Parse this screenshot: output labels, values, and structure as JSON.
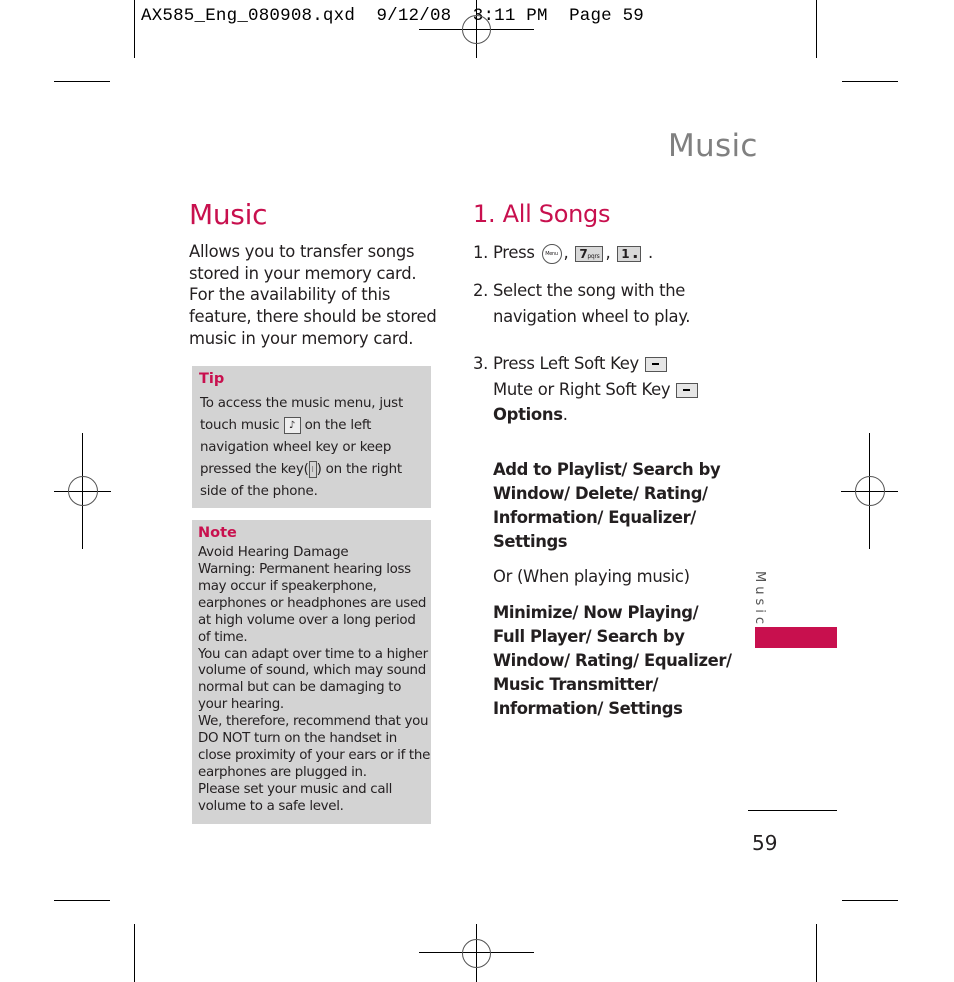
{
  "slug": "AX585_Eng_080908.qxd  9/12/08  3:11 PM  Page 59",
  "running_title": "Music",
  "left_column": {
    "heading": "Music",
    "intro": "Allows you to transfer songs stored in your memory card. For the availability of this feature, there should be stored music in your memory card.",
    "tip": {
      "label": "Tip",
      "text_1": "To access the music menu, just touch music",
      "music_icon": "music-note-icon",
      "text_2": "on the left navigation wheel key or keep pressed the key(",
      "side_key_icon": "side-key-icon",
      "text_3": ") on the right side of the phone."
    },
    "note": {
      "label": "Note",
      "subheading": "Avoid Hearing Damage",
      "paragraphs": [
        "Warning: Permanent hearing loss may occur if speakerphone, earphones or headphones are used at high volume over a long period of time.",
        "You can adapt over time to a higher volume of sound, which may sound normal but can be damaging to your hearing.",
        "We, therefore, recommend that you DO NOT turn on the handset in close proximity of your ears or if the earphones are plugged in.",
        "Please set your music and call volume to a safe level."
      ]
    }
  },
  "right_column": {
    "heading": "1. All Songs",
    "step1": {
      "prefix": "1. Press",
      "keys": [
        "Menu",
        "7",
        "pqrs",
        "1",
        "▪"
      ],
      "separator": ",",
      "end": "."
    },
    "step2_line1": "2. Select the song with the",
    "step2_line2": "navigation wheel to play.",
    "step3_line1": "3. Press Left Soft Key",
    "step3_line2": "Mute or Right Soft Key",
    "step3_options": "Options",
    "step3_end": ".",
    "options_list": [
      "Add to Playlist/ Search by",
      "Window/ Delete/ Rating/",
      "Information/ Equalizer/",
      "Settings"
    ],
    "or_text": "Or (When playing music)",
    "playing_options": [
      "Minimize/ Now Playing/",
      "Full Player/ Search by",
      "Window/ Rating/ Equalizer/",
      "Music Transmitter/",
      "Information/ Settings"
    ]
  },
  "side_tab": {
    "label": "Music",
    "color": "#c8104e"
  },
  "page_number": "59",
  "colors": {
    "accent": "#c8104e",
    "box_gray": "#d3d3d3",
    "running_title": "#808080"
  }
}
